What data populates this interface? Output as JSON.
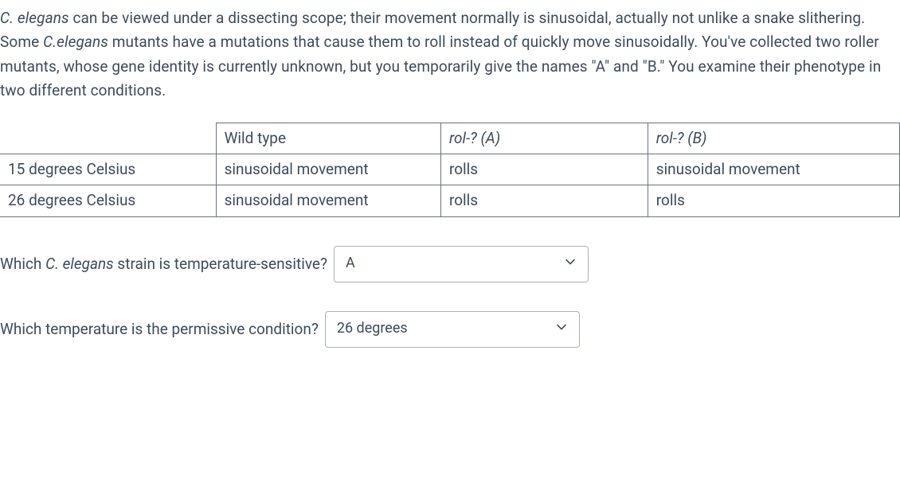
{
  "paragraph": {
    "p1a": "C. elegans",
    "p1b": " can be viewed under a dissecting scope; their movement normally is sinusoidal, actually not unlike a snake slithering. Some ",
    "p1c": "C.elegans",
    "p1d": " mutants have a mutations that cause them to roll instead of quickly move sinusoidally. You've collected two roller mutants, whose gene identity is currently unknown, but you temporarily give the names \"A\" and \"B.\" You examine their phenotype in two different conditions."
  },
  "table": {
    "header": {
      "c1": "",
      "c2": "Wild type",
      "c3": "rol-? (A)",
      "c4": "rol-? (B)"
    },
    "row1": {
      "c1": "15 degrees Celsius",
      "c2": "sinusoidal movement",
      "c3": "rolls",
      "c4": "sinusoidal movement"
    },
    "row2": {
      "c1": "26 degrees Celsius",
      "c2": "sinusoidal movement",
      "c3": "rolls",
      "c4": "rolls"
    }
  },
  "question1": {
    "text_a": "Which ",
    "text_b": "C. elegans",
    "text_c": " strain is temperature-sensitive?",
    "selected": "A"
  },
  "question2": {
    "text": "Which temperature is the permissive condition?",
    "selected": "26 degrees"
  }
}
